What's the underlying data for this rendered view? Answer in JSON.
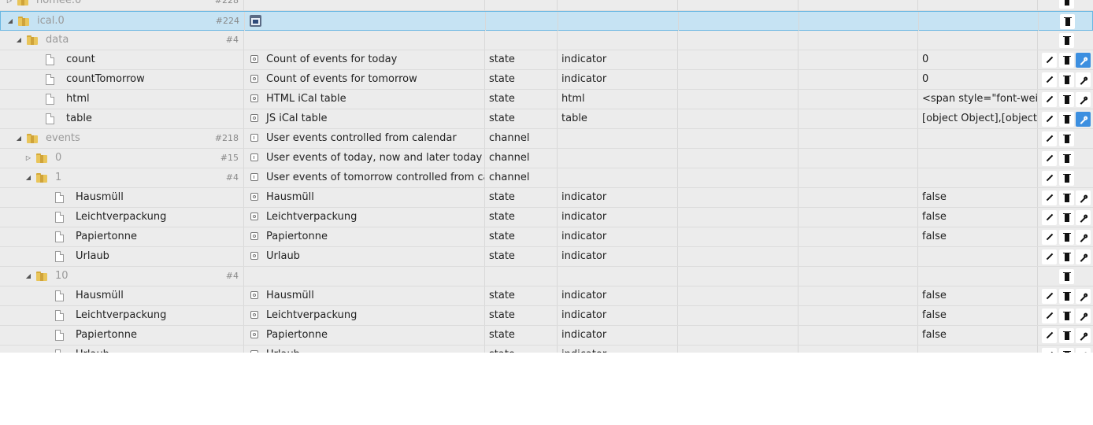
{
  "rows": [
    {
      "type": "folder",
      "indent": 0,
      "toggle": "collapsed",
      "name": "homee.0",
      "muted": true,
      "count": "#228",
      "desc": "",
      "obj_type": "",
      "role": "",
      "value": "",
      "icon": "top",
      "actions": [
        "delete"
      ],
      "partial_top": true
    },
    {
      "type": "folder",
      "indent": 0,
      "toggle": "expanded",
      "name": "ical.0",
      "muted": true,
      "count": "#224",
      "desc": "",
      "obj_type": "",
      "role": "",
      "value": "",
      "icon": "ical",
      "actions": [
        "delete"
      ],
      "selected": true
    },
    {
      "type": "folder",
      "indent": 1,
      "toggle": "expanded",
      "name": "data",
      "muted": true,
      "count": "#4",
      "desc": "",
      "obj_type": "",
      "role": "",
      "value": "",
      "icon": "",
      "actions": [
        "delete"
      ]
    },
    {
      "type": "file",
      "indent": 2,
      "name": "count",
      "desc": "Count of events for today",
      "obj_type": "state",
      "role": "indicator",
      "value": "0",
      "icon": "state",
      "actions": [
        "edit",
        "delete",
        "config"
      ],
      "config_active": true
    },
    {
      "type": "file",
      "indent": 2,
      "name": "countTomorrow",
      "desc": "Count of events for tomorrow",
      "obj_type": "state",
      "role": "indicator",
      "value": "0",
      "icon": "state",
      "actions": [
        "edit",
        "delete",
        "config"
      ]
    },
    {
      "type": "file",
      "indent": 2,
      "name": "html",
      "desc": "HTML iCal table",
      "obj_type": "state",
      "role": "html",
      "value": "<span style=\"font-weight",
      "icon": "state",
      "actions": [
        "edit",
        "delete",
        "config"
      ]
    },
    {
      "type": "file",
      "indent": 2,
      "name": "table",
      "desc": "JS iCal table",
      "obj_type": "state",
      "role": "table",
      "value": "[object Object],[object Ob",
      "icon": "state",
      "actions": [
        "edit",
        "delete",
        "config"
      ],
      "config_active": true
    },
    {
      "type": "folder",
      "indent": 1,
      "toggle": "expanded",
      "name": "events",
      "muted": true,
      "count": "#218",
      "desc": "User events controlled from calendar",
      "obj_type": "channel",
      "role": "",
      "value": "",
      "icon": "channel",
      "actions": [
        "edit",
        "delete"
      ]
    },
    {
      "type": "folder",
      "indent": 2,
      "toggle": "collapsed",
      "name": "0",
      "muted": true,
      "count": "#15",
      "desc": "User events of today, now and later today con...",
      "obj_type": "channel",
      "role": "",
      "value": "",
      "icon": "channel",
      "actions": [
        "edit",
        "delete"
      ]
    },
    {
      "type": "folder",
      "indent": 2,
      "toggle": "expanded",
      "name": "1",
      "muted": true,
      "count": "#4",
      "desc": "User events of tomorrow controlled from cale...",
      "obj_type": "channel",
      "role": "",
      "value": "",
      "icon": "channel",
      "actions": [
        "edit",
        "delete"
      ]
    },
    {
      "type": "file",
      "indent": 3,
      "name": "Hausmüll",
      "desc": "Hausmüll",
      "obj_type": "state",
      "role": "indicator",
      "value": "false",
      "icon": "state",
      "actions": [
        "edit",
        "delete",
        "config"
      ]
    },
    {
      "type": "file",
      "indent": 3,
      "name": "Leichtverpackung",
      "desc": "Leichtverpackung",
      "obj_type": "state",
      "role": "indicator",
      "value": "false",
      "icon": "state",
      "actions": [
        "edit",
        "delete",
        "config"
      ]
    },
    {
      "type": "file",
      "indent": 3,
      "name": "Papiertonne",
      "desc": "Papiertonne",
      "obj_type": "state",
      "role": "indicator",
      "value": "false",
      "icon": "state",
      "actions": [
        "edit",
        "delete",
        "config"
      ]
    },
    {
      "type": "file",
      "indent": 3,
      "name": "Urlaub",
      "desc": "Urlaub",
      "obj_type": "state",
      "role": "indicator",
      "value": "",
      "icon": "state",
      "actions": [
        "edit",
        "delete",
        "config"
      ]
    },
    {
      "type": "folder",
      "indent": 2,
      "toggle": "expanded",
      "name": "10",
      "muted": true,
      "count": "#4",
      "desc": "",
      "obj_type": "",
      "role": "",
      "value": "",
      "icon": "",
      "actions": [
        "delete"
      ]
    },
    {
      "type": "file",
      "indent": 3,
      "name": "Hausmüll",
      "desc": "Hausmüll",
      "obj_type": "state",
      "role": "indicator",
      "value": "false",
      "icon": "state",
      "actions": [
        "edit",
        "delete",
        "config"
      ]
    },
    {
      "type": "file",
      "indent": 3,
      "name": "Leichtverpackung",
      "desc": "Leichtverpackung",
      "obj_type": "state",
      "role": "indicator",
      "value": "false",
      "icon": "state",
      "actions": [
        "edit",
        "delete",
        "config"
      ]
    },
    {
      "type": "file",
      "indent": 3,
      "name": "Papiertonne",
      "desc": "Papiertonne",
      "obj_type": "state",
      "role": "indicator",
      "value": "false",
      "icon": "state",
      "actions": [
        "edit",
        "delete",
        "config"
      ]
    },
    {
      "type": "file",
      "indent": 3,
      "name": "Urlaub",
      "desc": "Urlaub",
      "obj_type": "state",
      "role": "indicator",
      "value": "",
      "icon": "state",
      "actions": [
        "edit",
        "delete",
        "config"
      ],
      "partial_bottom": true
    }
  ],
  "colors": {
    "row_bg": "#ececec",
    "selected_bg": "#c6e3f3",
    "selected_border": "#6ab7e2",
    "config_active": "#3c8fe0",
    "folder": "#e9c55a"
  }
}
